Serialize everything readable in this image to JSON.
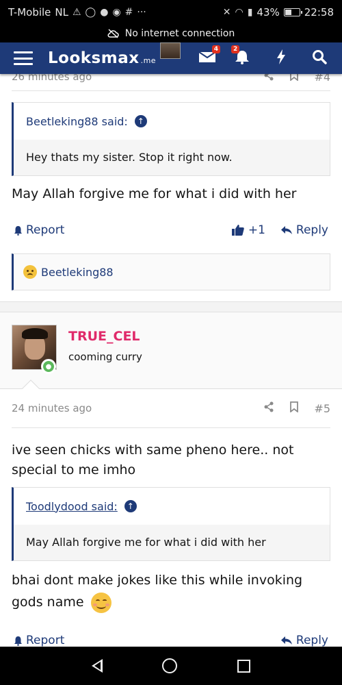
{
  "status_bar": {
    "carrier": "T-Mobile",
    "region": "NL",
    "battery": "43%",
    "battery_level": 0.43,
    "time": "22:58"
  },
  "network_banner": {
    "text": "No internet connection",
    "icon": "cloud-off-icon"
  },
  "header": {
    "logo": "Looksmax",
    "logo_suffix": ".me",
    "inbox_badge": "4",
    "alerts_badge": "2",
    "icons": [
      "menu-icon",
      "inbox-icon",
      "bell-icon",
      "bolt-icon",
      "search-icon"
    ]
  },
  "post4": {
    "time": "26 minutes ago",
    "number": "#4",
    "quote": {
      "author": "Beetleking88 said:",
      "text": "Hey thats my sister. Stop it right now."
    },
    "message": "May Allah forgive me for what i did with her",
    "report": "Report",
    "reaction_count": "+1",
    "reply": "Reply",
    "reaction_user": "Beetleking88"
  },
  "post5": {
    "user_name": "TRUE_CEL",
    "user_title": "cooming curry",
    "time": "24 minutes ago",
    "number": "#5",
    "message": "ive seen chicks with same pheno here.. not special to me imho",
    "quote": {
      "author": "Toodlydood said:",
      "text": "May Allah forgive me for what i did with her"
    },
    "message2": "bhai dont make jokes like this while invoking gods name",
    "report": "Report",
    "reply": "Reply"
  }
}
